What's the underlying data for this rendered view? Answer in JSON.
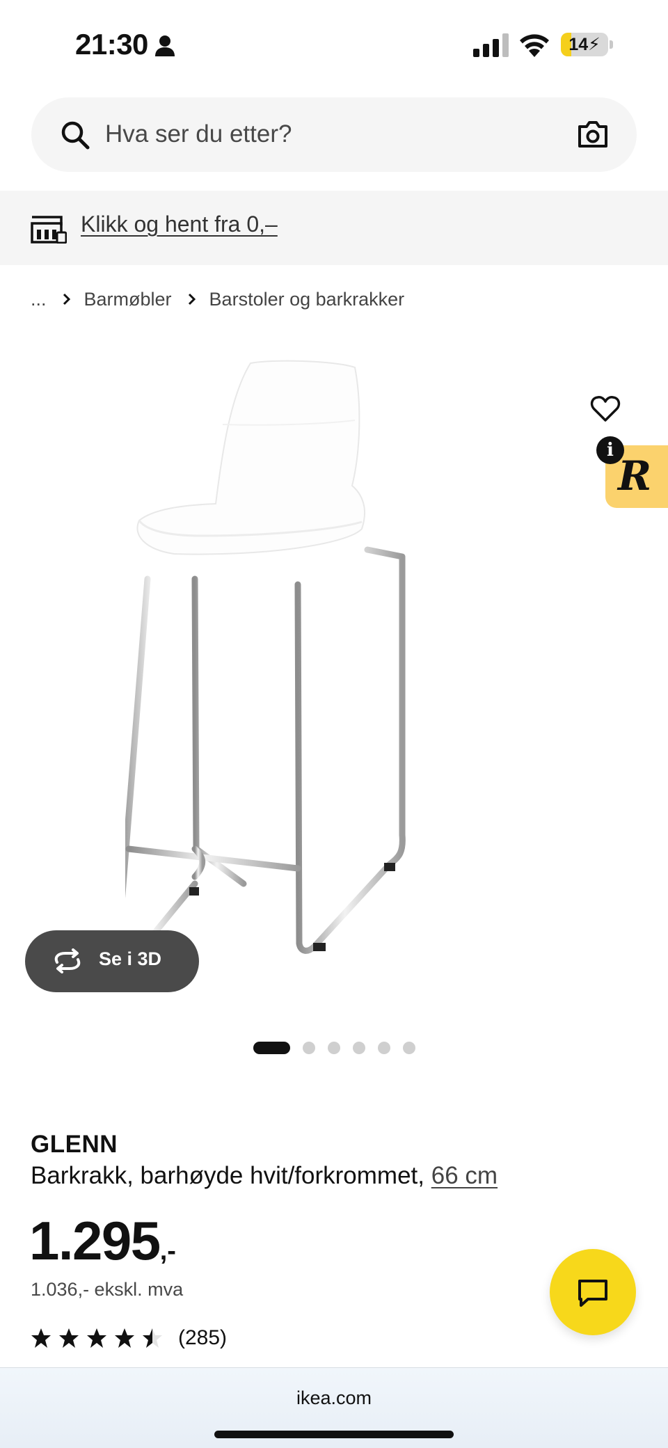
{
  "status_bar": {
    "time": "21:30",
    "battery_level": "14",
    "battery_fill_fraction": 0.14,
    "icons": [
      "person-icon",
      "cellular-signal-icon",
      "wifi-icon",
      "battery-charging-icon"
    ]
  },
  "search": {
    "placeholder": "Hva ser du etter?",
    "icons": [
      "search-icon",
      "camera-icon"
    ]
  },
  "promo": {
    "link_text": "Klikk og hent fra 0,–",
    "icon": "store-pickup-icon"
  },
  "breadcrumb": {
    "items": [
      "...",
      "Barmøbler",
      "Barstoler og barkrakker"
    ]
  },
  "gallery": {
    "view_3d_label": "Se i 3D",
    "image_count": 6,
    "active_index": 0
  },
  "extension_badge": {
    "letter": "R",
    "info_glyph": "i"
  },
  "product": {
    "name": "GLENN",
    "description": "Barkrakk, barhøyde hvit/forkrommet, ",
    "size_link": "66 cm",
    "price_main": "1.295",
    "price_suffix": ",-",
    "price_ex_vat": "1.036,- ekskl. mva",
    "rating_value": 4.5,
    "rating_max": 5,
    "review_count": "(285)"
  },
  "browser": {
    "url": "ikea.com"
  },
  "colors": {
    "brand_yellow": "#f7d81b",
    "text": "#111111",
    "muted_text": "#484848",
    "surface": "#f5f5f5",
    "view_3d_bg": "#4a4a4a"
  }
}
